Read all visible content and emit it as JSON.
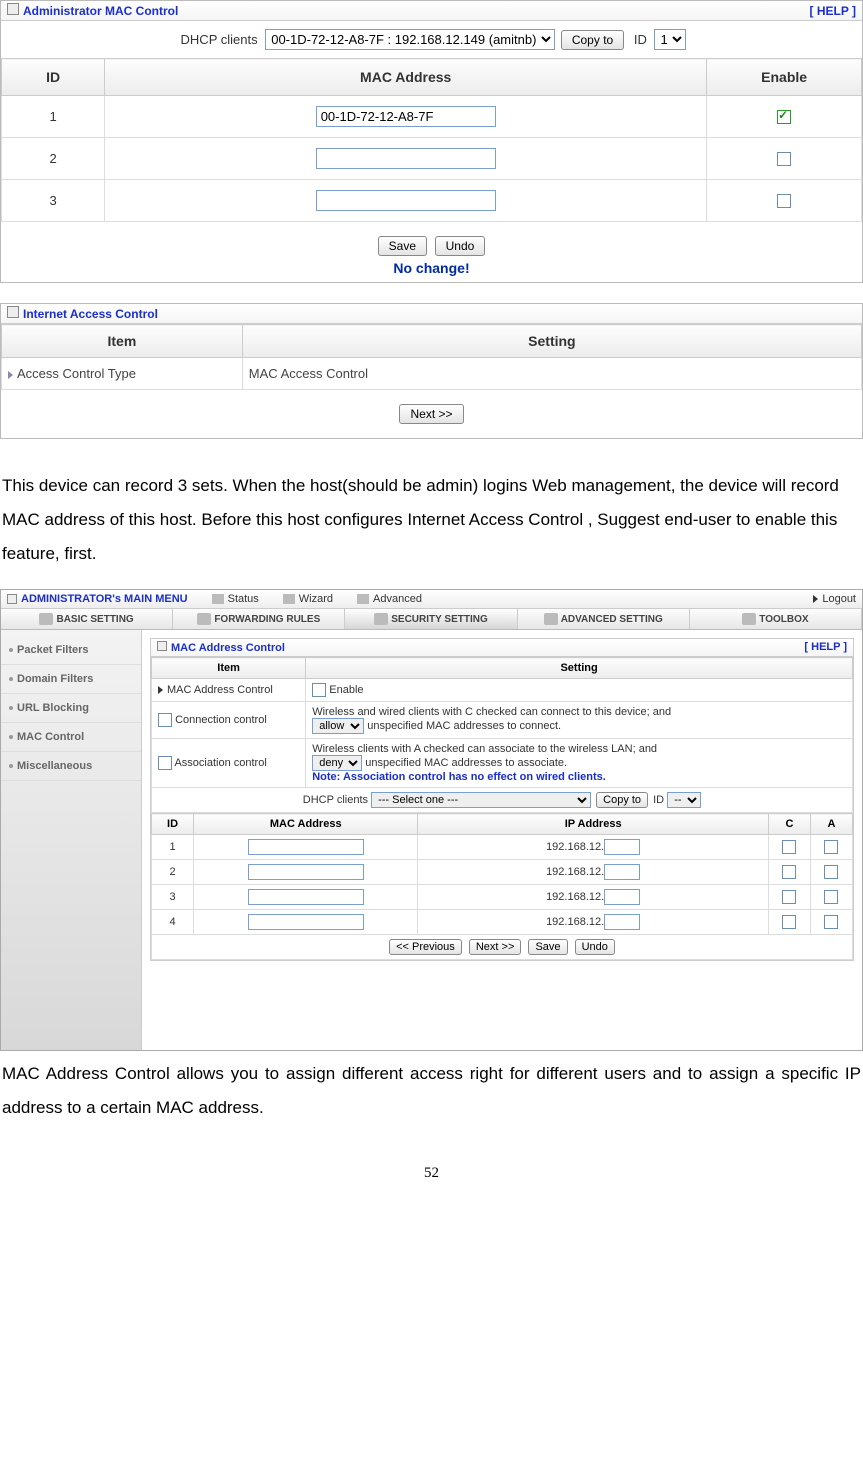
{
  "panel1": {
    "title": "Administrator MAC Control",
    "help": "[ HELP ]",
    "dhcp_label": "DHCP clients",
    "dhcp_selected": "00-1D-72-12-A8-7F : 192.168.12.149 (amitnb)",
    "copy_btn": "Copy to",
    "id_label": "ID",
    "id_selected": "1",
    "headers": {
      "id": "ID",
      "mac": "MAC Address",
      "enable": "Enable"
    },
    "rows": [
      {
        "id": "1",
        "mac": "00-1D-72-12-A8-7F",
        "enabled": true
      },
      {
        "id": "2",
        "mac": "",
        "enabled": false
      },
      {
        "id": "3",
        "mac": "",
        "enabled": false
      }
    ],
    "save_btn": "Save",
    "undo_btn": "Undo",
    "no_change": "No change!"
  },
  "panel2": {
    "title": "Internet Access Control",
    "headers": {
      "item": "Item",
      "setting": "Setting"
    },
    "row_label": "Access Control Type",
    "row_value": "MAC Access Control",
    "next_btn": "Next >>"
  },
  "para1": "This device can record 3 sets. When the host(should be admin) logins Web management, the device will record MAC address of this host. Before this host configures Internet Access Control , Suggest end-user to enable this feature, first.",
  "shot2": {
    "main_menu": "ADMINISTRATOR's MAIN MENU",
    "menu_items": [
      "Status",
      "Wizard",
      "Advanced"
    ],
    "logout": "Logout",
    "tabs": [
      "BASIC SETTING",
      "FORWARDING RULES",
      "SECURITY SETTING",
      "ADVANCED SETTING",
      "TOOLBOX"
    ],
    "sidebar": [
      "Packet Filters",
      "Domain Filters",
      "URL Blocking",
      "MAC Control",
      "Miscellaneous"
    ],
    "inner": {
      "title": "MAC Address Control",
      "help": "[ HELP ]",
      "headers": {
        "item": "Item",
        "setting": "Setting"
      },
      "r1_label": "MAC Address Control",
      "r1_setting": "Enable",
      "r2_label": "Connection control",
      "r2_text_a": "Wireless and wired clients with C checked can connect to this device; and",
      "r2_select": "allow",
      "r2_text_b": "unspecified MAC addresses to connect.",
      "r3_label": "Association control",
      "r3_text_a": "Wireless clients with A checked can associate to the wireless LAN; and",
      "r3_select": "deny",
      "r3_text_b": "unspecified MAC addresses to associate.",
      "r3_note": "Note: Association control has no effect on wired clients.",
      "dhcp_label": "DHCP clients",
      "dhcp_selected": "--- Select one ---",
      "copy_btn": "Copy to",
      "id_label": "ID",
      "id_selected": "--",
      "tbl_headers": {
        "id": "ID",
        "mac": "MAC Address",
        "ip": "IP Address",
        "c": "C",
        "a": "A"
      },
      "ip_prefix": "192.168.12.",
      "rows": [
        "1",
        "2",
        "3",
        "4"
      ],
      "prev_btn": "<< Previous",
      "next_btn": "Next >>",
      "save_btn": "Save",
      "undo_btn": "Undo"
    }
  },
  "para2": "MAC Address Control allows you to assign different access right for different users and to assign a specific IP address to a certain MAC address.",
  "page_num": "52"
}
